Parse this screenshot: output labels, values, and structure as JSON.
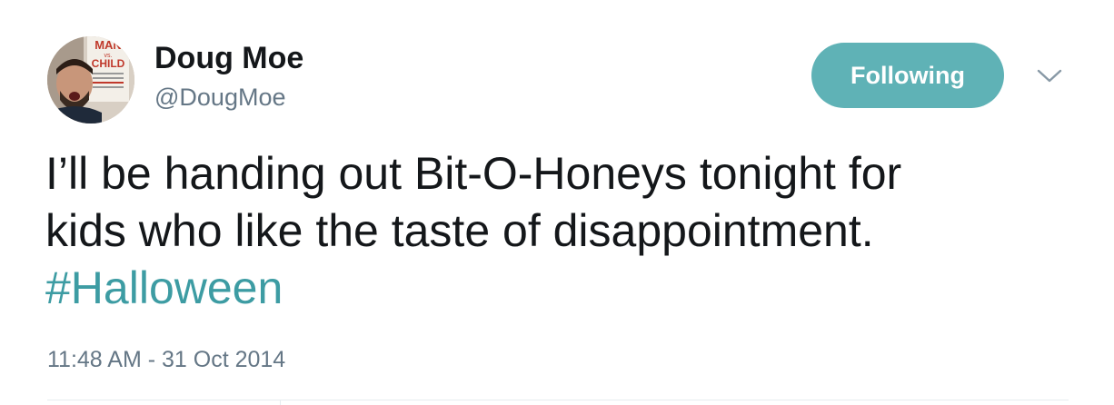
{
  "user": {
    "display_name": "Doug Moe",
    "handle": "@DougMoe",
    "avatar_book_title_top": "MAN",
    "avatar_book_title_mid": "vs.",
    "avatar_book_title_bottom": "CHILD"
  },
  "follow_button": {
    "label": "Following",
    "color": "#5fb2b6"
  },
  "menu_icon": "chevron-down-icon",
  "tweet": {
    "lines": [
      "I’ll be handing out Bit-O-Honeys tonight for",
      "kids who like the taste of disappointment."
    ],
    "hashtag": "#Halloween",
    "hashtag_color": "#3d9ca3",
    "timestamp": "11:48 AM - 31 Oct 2014"
  }
}
